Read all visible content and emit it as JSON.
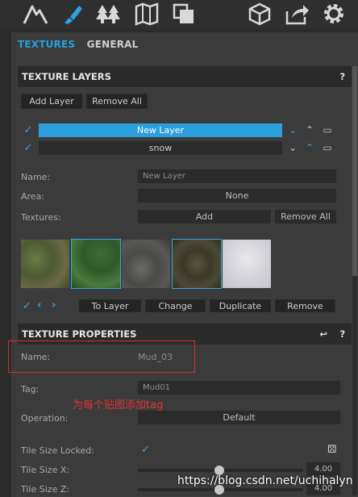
{
  "toolbar": {
    "icons": [
      "mountain-icon",
      "brush-icon",
      "trees-icon",
      "map-icon",
      "layers-copy-icon",
      "cube-icon",
      "share-icon",
      "gear-icon"
    ]
  },
  "tabs": {
    "textures": "TEXTURES",
    "general": "GENERAL"
  },
  "texture_layers": {
    "header": "TEXTURE LAYERS",
    "help": "?",
    "add_layer": "Add Layer",
    "remove_all": "Remove All",
    "layers": [
      {
        "name": "New Layer",
        "selected": true
      },
      {
        "name": "snow",
        "selected": false
      }
    ],
    "name_label": "Name:",
    "name_value": "New Layer",
    "area_label": "Area:",
    "area_value": "None",
    "textures_label": "Textures:",
    "add_button": "Add",
    "remove_all_button": "Remove All",
    "actions": {
      "to_layer": "To Layer",
      "change": "Change",
      "duplicate": "Duplicate",
      "remove": "Remove"
    }
  },
  "texture_properties": {
    "header": "TEXTURE PROPERTIES",
    "help": "?",
    "name_label": "Name:",
    "name_value": "Mud_03",
    "tag_label": "Tag:",
    "tag_value": "Mud01",
    "operation_label": "Operation:",
    "operation_value": "Default",
    "tile_size_locked_label": "Tile Size Locked:",
    "tile_size_x_label": "Tile Size X:",
    "tile_size_x_value": "4.00",
    "tile_size_z_label": "Tile Size Z:",
    "tile_size_z_value": "4.00"
  },
  "annotation_text": "为每个贴图添加tag",
  "watermark": "https://blog.csdn.net/uchihalyn"
}
